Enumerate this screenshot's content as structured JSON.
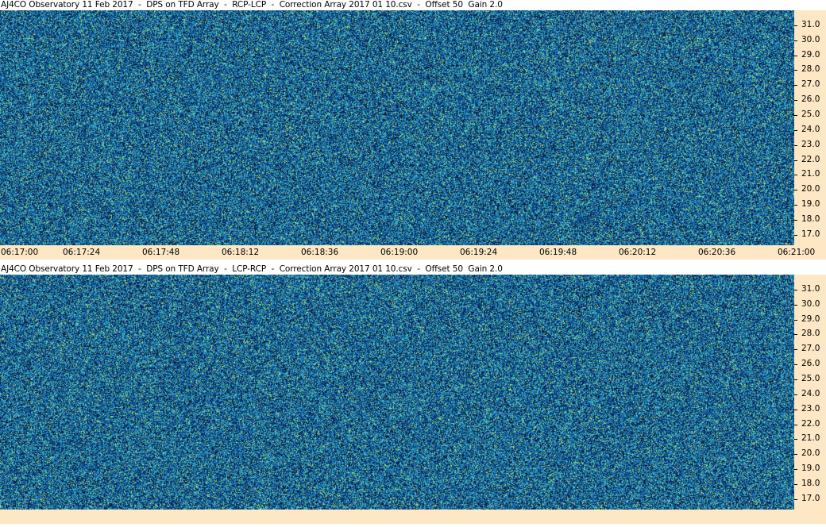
{
  "chart_data": [
    {
      "type": "heatmap",
      "title": "AJ4CO Observatory 11 Feb 2017  -  DPS on TFD Array  -  RCP-LCP  -  Correction Array 2017 01 10.csv  -  Offset 50  Gain 2.0",
      "x_tick_labels": [
        "06:17:00",
        "06:17:24",
        "06:17:48",
        "06:18:12",
        "06:18:36",
        "06:19:00",
        "06:19:24",
        "06:19:48",
        "06:20:12",
        "06:20:36",
        "06:21:00"
      ],
      "xlim": [
        "06:17:00",
        "06:21:00"
      ],
      "y_tick_labels": [
        "31.0",
        "30.0",
        "29.0",
        "28.0",
        "27.0",
        "26.0",
        "25.0",
        "24.0",
        "23.0",
        "22.0",
        "21.0",
        "20.0",
        "19.0",
        "18.0",
        "17.0"
      ],
      "ylim": [
        16.3,
        32.0
      ],
      "colors": [
        "#07163a",
        "#0d3e82",
        "#1a6fb3",
        "#2aa6c9",
        "#55d0a8",
        "#c8e65a"
      ]
    },
    {
      "type": "heatmap",
      "title": "AJ4CO Observatory 11 Feb 2017  -  DPS on TFD Array  -  LCP-RCP  -  Correction Array 2017 01 10.csv  -  Offset 50  Gain 2.0",
      "y_tick_labels": [
        "31.0",
        "30.0",
        "29.0",
        "28.0",
        "27.0",
        "26.0",
        "25.0",
        "24.0",
        "23.0",
        "22.0",
        "21.0",
        "20.0",
        "19.0",
        "18.0",
        "17.0"
      ],
      "ylim": [
        16.3,
        32.0
      ],
      "colors": [
        "#07163a",
        "#0d3e82",
        "#1a6fb3",
        "#2aa6c9",
        "#55d0a8",
        "#c8e65a"
      ]
    }
  ]
}
